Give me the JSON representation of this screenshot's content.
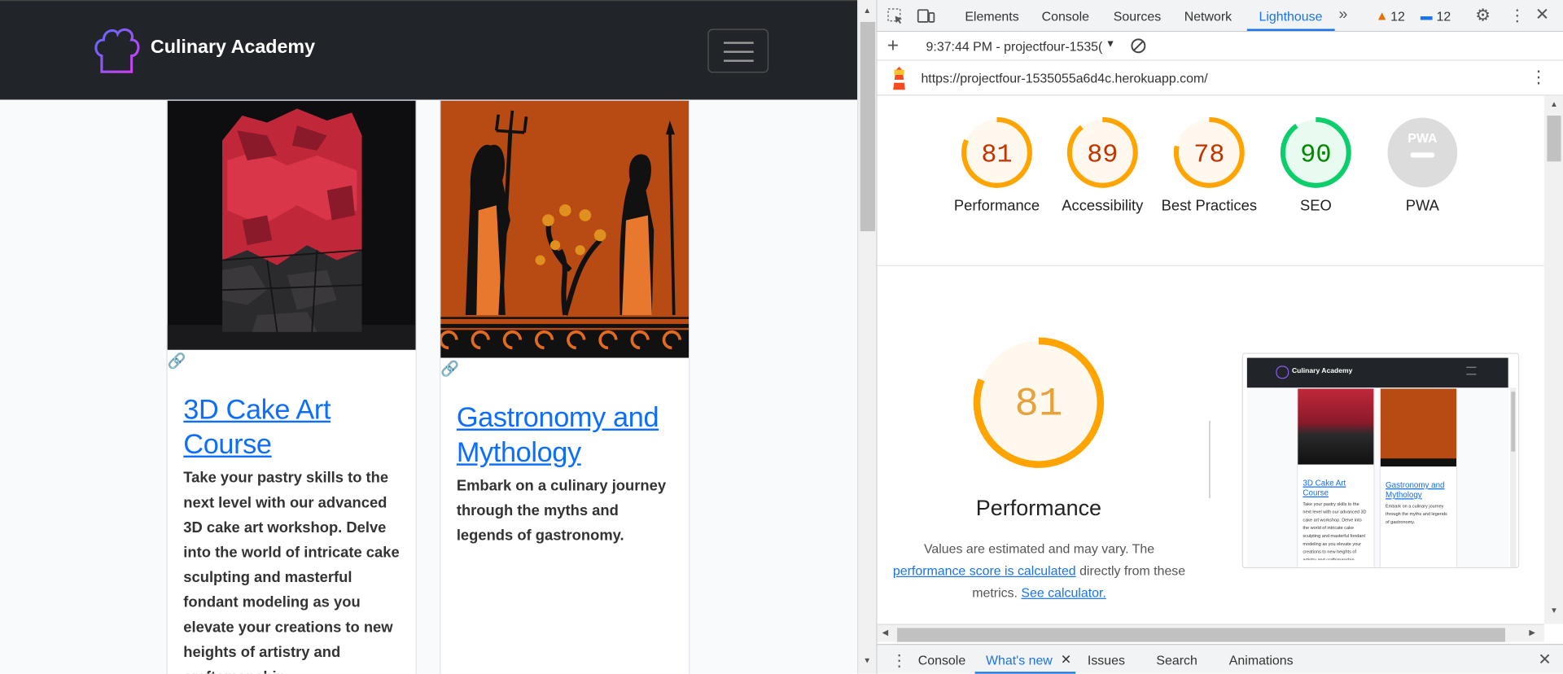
{
  "site": {
    "brand": "Culinary Academy",
    "cards": [
      {
        "title": "3D Cake Art Course",
        "text": "Take your pastry skills to the next level with our advanced 3D cake art workshop. Delve into the world of intricate cake sculpting and masterful fondant modeling as you elevate your creations to new heights of artistry and craftsmanship."
      },
      {
        "title": "Gastronomy and Mythology",
        "text": "Embark on a culinary journey through the myths and legends of gastronomy."
      }
    ]
  },
  "devtools": {
    "tabs": [
      "Elements",
      "Console",
      "Sources",
      "Network",
      "Lighthouse"
    ],
    "active_tab": "Lighthouse",
    "warnings_count": "12",
    "messages_count": "12",
    "report_selector": "9:37:44 PM - projectfour-1535(",
    "url": "https://projectfour-1535055a6d4c.herokuapp.com/",
    "scores": [
      {
        "label": "Performance",
        "value": "81",
        "color": "#ffa400"
      },
      {
        "label": "Accessibility",
        "value": "89",
        "color": "#ffa400"
      },
      {
        "label": "Best Practices",
        "value": "78",
        "color": "#ffa400"
      },
      {
        "label": "SEO",
        "value": "90",
        "color": "#0cce6b"
      },
      {
        "label": "PWA",
        "value": "",
        "color": "#cccccc"
      }
    ],
    "pwa_badge": "PWA",
    "performance": {
      "score": "81",
      "title": "Performance",
      "note_before": "Values are estimated and may vary. The ",
      "note_link": "performance score is calculated",
      "note_middle": " directly from these metrics. ",
      "note_link2": "See calculator."
    },
    "drawer_tabs": [
      "Console",
      "What's new",
      "Issues",
      "Search",
      "Animations"
    ],
    "drawer_active": "What's new"
  },
  "colors": {
    "accent": "#1a73e8",
    "link": "#0d6efd",
    "navbar": "#212529",
    "orange": "#ffa400",
    "green": "#0cce6b"
  }
}
